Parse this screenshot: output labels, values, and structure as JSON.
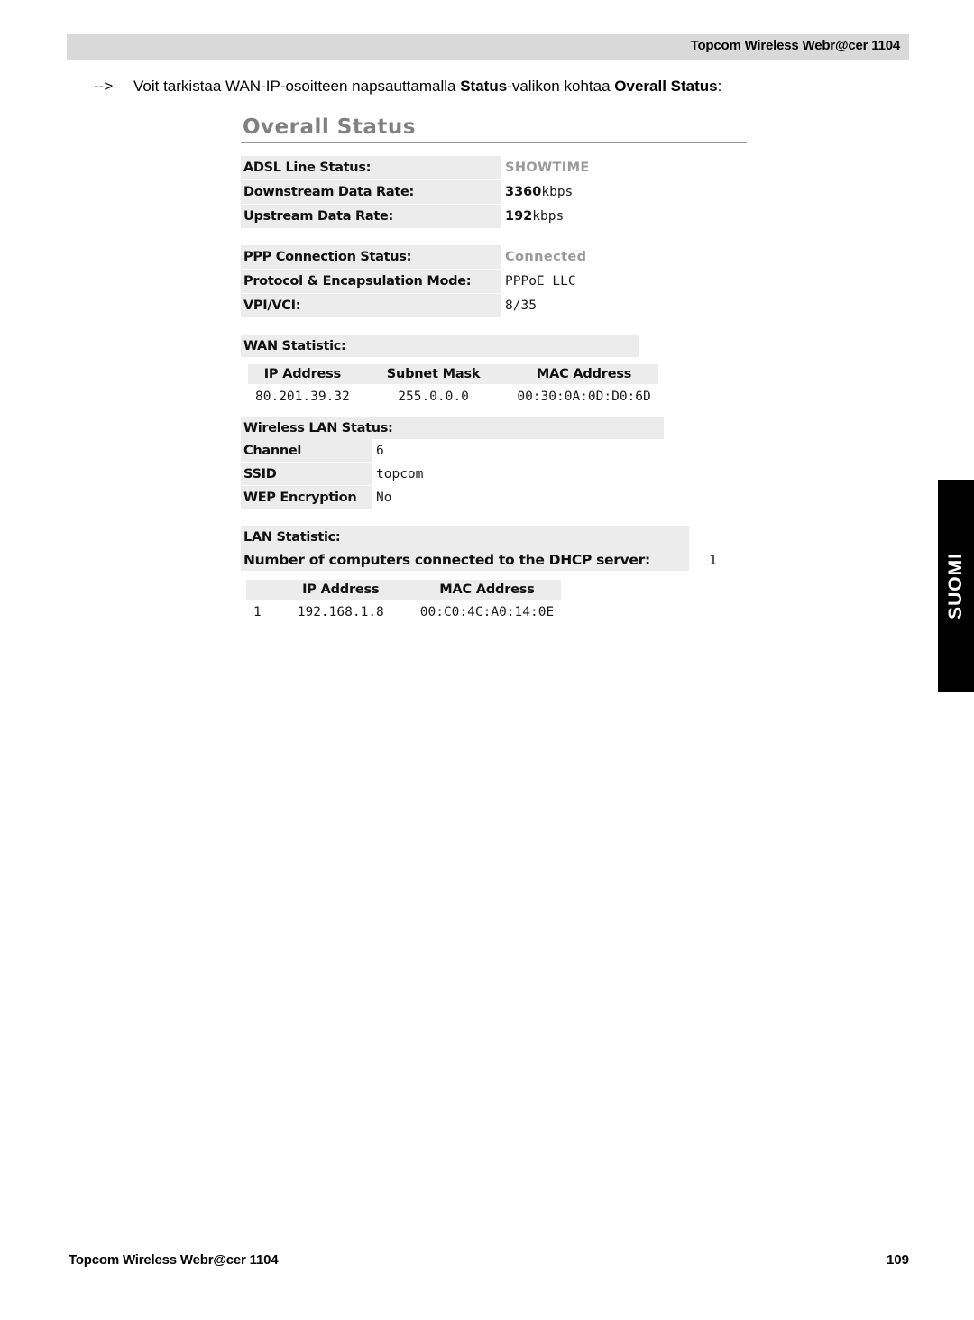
{
  "page": {
    "header_title": "Topcom Wireless Webr@cer 1104",
    "footer_left": "Topcom Wireless Webr@cer 1104",
    "footer_page_number": "109",
    "language_tab": "SUOMI",
    "colors": {
      "header_band": "#d9d9d9",
      "label_cell": "#ececec",
      "panel_title": "#808080",
      "muted_value": "#999999",
      "language_tab_bg": "#000000"
    }
  },
  "intro": {
    "arrow": "-->",
    "text_part1": "Voit tarkistaa WAN-IP-osoitteen napsauttamalla ",
    "bold1": "Status",
    "text_part2": "-valikon kohtaa ",
    "bold2": "Overall Status",
    "text_part3": ":"
  },
  "router_ui": {
    "panel_title": "Overall Status",
    "adsl": {
      "rows": [
        {
          "label": "ADSL Line Status:",
          "value": "SHOWTIME",
          "style": "muted"
        },
        {
          "label": "Downstream Data Rate:",
          "value": "3360",
          "unit": "kbps",
          "style": "number"
        },
        {
          "label": "Upstream Data Rate:",
          "value": "192",
          "unit": "kbps",
          "style": "number"
        }
      ]
    },
    "ppp": {
      "rows": [
        {
          "label": "PPP Connection Status:",
          "value": "Connected",
          "style": "muted"
        },
        {
          "label": "Protocol & Encapsulation Mode:",
          "value": "PPPoE LLC",
          "style": "plain"
        },
        {
          "label": "VPI/VCI:",
          "value": "8/35",
          "style": "plain"
        }
      ]
    },
    "wan_statistic": {
      "section_title": "WAN Statistic:",
      "columns": [
        "IP Address",
        "Subnet Mask",
        "MAC Address"
      ],
      "rows": [
        [
          "80.201.39.32",
          "255.0.0.0",
          "00:30:0A:0D:D0:6D"
        ]
      ]
    },
    "wireless_lan_status": {
      "section_title": "Wireless LAN Status:",
      "rows": [
        {
          "label": "Channel",
          "value": "6"
        },
        {
          "label": "SSID",
          "value": "topcom"
        },
        {
          "label": "WEP Encryption",
          "value": "No"
        }
      ]
    },
    "lan_statistic": {
      "section_title": "LAN Statistic:",
      "dhcp_label": "Number of computers connected to the DHCP server:",
      "dhcp_count": "1",
      "columns": [
        "",
        "IP Address",
        "MAC Address"
      ],
      "rows": [
        [
          "1",
          "192.168.1.8",
          "00:C0:4C:A0:14:0E"
        ]
      ]
    }
  }
}
